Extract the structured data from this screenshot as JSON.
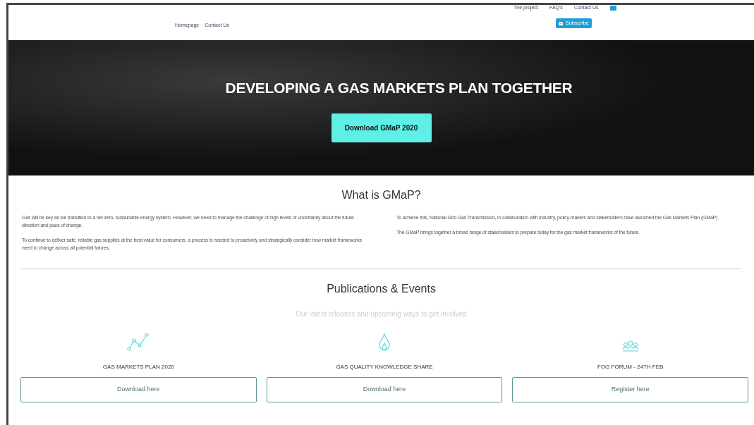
{
  "top_links": [
    "The project",
    "FAQ's",
    "Contact Us"
  ],
  "nav": [
    "Homepage",
    "Contact Us"
  ],
  "subscribe": "Subscribe",
  "hero": {
    "title": "DEVELOPING A GAS MARKETS PLAN TOGETHER",
    "button": "Download GMaP 2020"
  },
  "about": {
    "title": "What is GMaP?",
    "left": [
      "Gas will be key as we transition to a net zero, sustainable energy system. However, we need to manage the challenge of high levels of uncertainty about the future direction and pace of change.",
      "To continue to deliver safe, reliable gas supplies at the best value for consumers, a process is needed to proactively and strategically  consider how market frameworks need to change across all potential futures."
    ],
    "right": [
      "To achieve this, National Grid Gas Transmission, in collaboration with industry, policy-makers and stakeholders have launched the Gas Markets Plan (GMaP).",
      "The GMaP brings together a broad range of stakeholders to prepare today for the gas market frameworks of the future."
    ]
  },
  "publications": {
    "title": "Publications & Events",
    "subtitle": "Our latest releases and upcoming ways to get involved",
    "items": [
      {
        "kind": "chart",
        "title": "GAS MARKETS PLAN 2020",
        "button": "Download here"
      },
      {
        "kind": "flame",
        "title": "GAS QUALITY KNOWLEDGE SHARE",
        "button": "Download here"
      },
      {
        "kind": "people",
        "title": "FOG FORUM - 24TH FEB",
        "button": "Register here"
      }
    ]
  }
}
